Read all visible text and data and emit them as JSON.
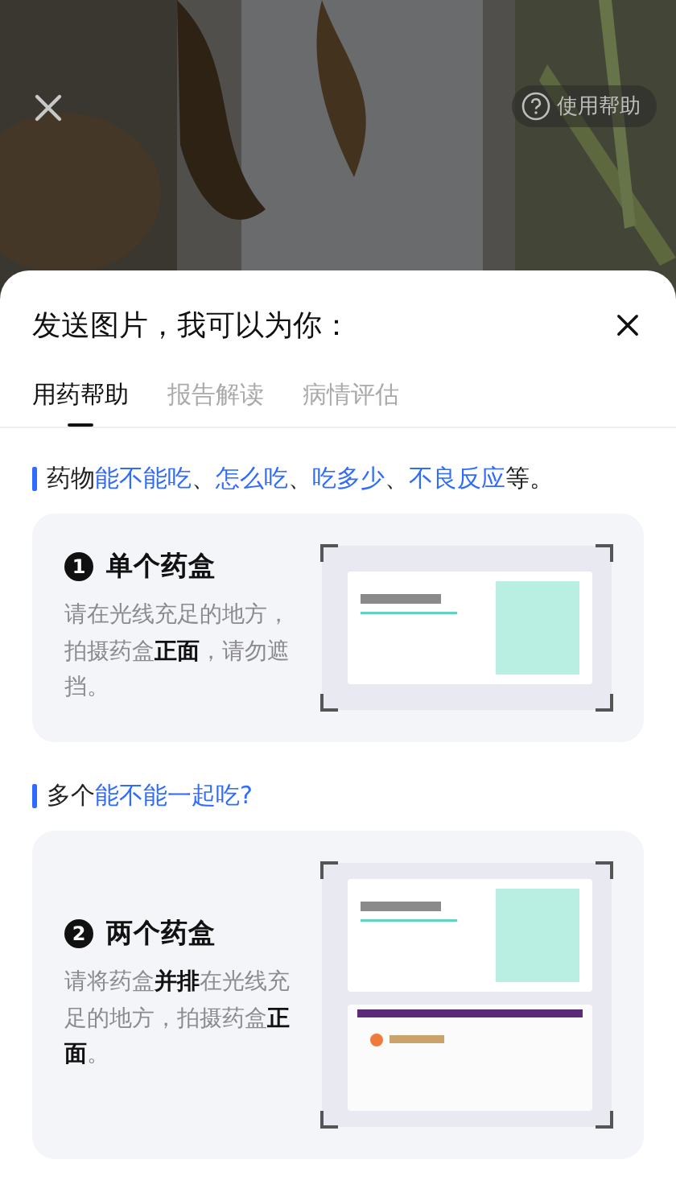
{
  "camera": {
    "kind": "picture",
    "help_button": {
      "label": "使用帮助"
    }
  },
  "sheet": {
    "title": "发送图片，我可以为你：",
    "tabs": [
      {
        "label": "用药帮助",
        "selected": true
      },
      {
        "label": "报告解读",
        "selected": false
      },
      {
        "label": "病情评估",
        "selected": false
      }
    ],
    "sections": [
      {
        "heading": [
          {
            "text": "药物",
            "highlight": false
          },
          {
            "text": "能不能吃",
            "highlight": true
          },
          {
            "text": "、",
            "highlight": false
          },
          {
            "text": "怎么吃",
            "highlight": true
          },
          {
            "text": "、",
            "highlight": false
          },
          {
            "text": "吃多少",
            "highlight": true
          },
          {
            "text": "、",
            "highlight": false
          },
          {
            "text": "不良反应",
            "highlight": true
          },
          {
            "text": "等。",
            "highlight": false
          }
        ],
        "card": {
          "number": "1",
          "title": "单个药盒",
          "description": "请在光线充足的地方，拍摄药盒**正面**，请勿遮挡。"
        }
      },
      {
        "heading": [
          {
            "text": "多个",
            "highlight": false
          },
          {
            "text": "能不能一起吃?",
            "highlight": true
          }
        ],
        "card": {
          "number": "2",
          "title": "两个药盒",
          "description": "请将药盒**并排**在光线充足的地方，拍摄药盒**正面**。"
        }
      }
    ]
  }
}
